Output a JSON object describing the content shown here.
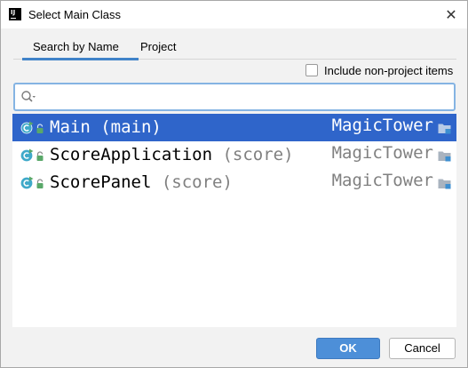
{
  "window": {
    "app_icon_text": "IJ",
    "title": "Select Main Class",
    "close_glyph": "✕"
  },
  "tabs": [
    {
      "label": "Search by Name",
      "active": true
    },
    {
      "label": "Project",
      "active": false
    }
  ],
  "include_non_project": {
    "label": "Include non-project items",
    "checked": false
  },
  "search": {
    "value": "",
    "placeholder": ""
  },
  "results": [
    {
      "name": "Main",
      "package": "(main)",
      "module": "MagicTower",
      "selected": true
    },
    {
      "name": "ScoreApplication",
      "package": "(score)",
      "module": "MagicTower",
      "selected": false
    },
    {
      "name": "ScorePanel",
      "package": "(score)",
      "module": "MagicTower",
      "selected": false
    }
  ],
  "buttons": {
    "ok": "OK",
    "cancel": "Cancel"
  },
  "colors": {
    "selection": "#2f65ca",
    "accent": "#4083c9",
    "class_icon": "#3fa9c9",
    "run_badge": "#59a869"
  },
  "icons": [
    "app-logo-icon",
    "close-icon",
    "search-icon",
    "class-icon",
    "lock-icon",
    "module-folder-icon"
  ]
}
